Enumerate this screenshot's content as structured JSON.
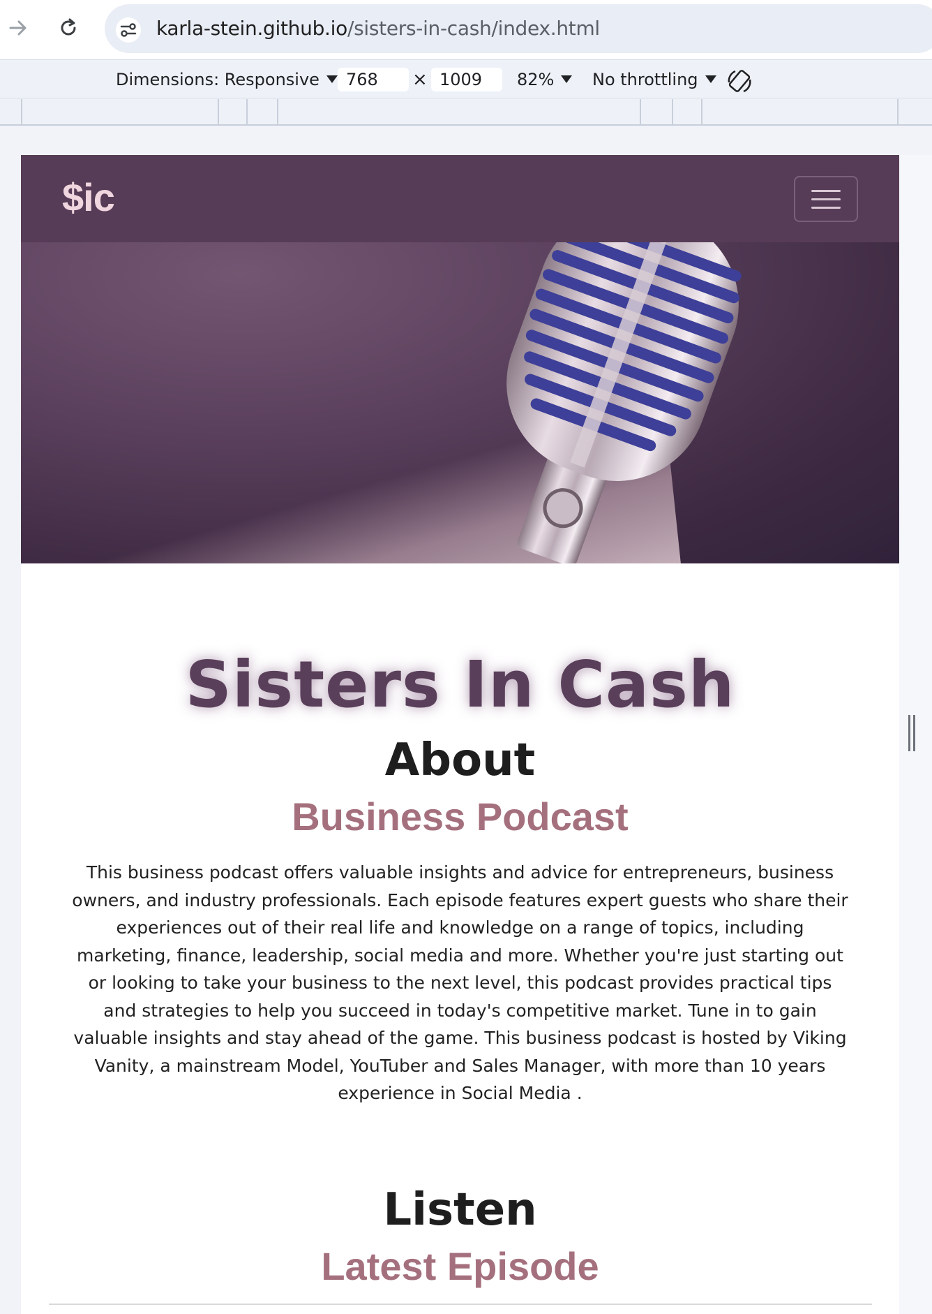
{
  "browser": {
    "url_host": "karla-stein.github.io",
    "url_path": "/sisters-in-cash/index.html"
  },
  "devtools": {
    "dimensions_label": "Dimensions: Responsive",
    "width_value": "768",
    "height_value": "1009",
    "times": "×",
    "zoom": "82%",
    "throttling": "No throttling"
  },
  "navbar": {
    "brand": "$ic"
  },
  "hero": {
    "image": "microphone-photo"
  },
  "main": {
    "title": "Sisters In Cash",
    "about_heading": "About",
    "about_subheading": "Business Podcast",
    "about_text": "This business podcast offers valuable insights and advice for entrepreneurs, business owners, and industry professionals. Each episode features expert guests who share their experiences out of their real life and knowledge on a range of topics, including marketing, finance, leadership, social media and more. Whether you're just starting out or looking to take your business to the next level, this podcast provides practical tips and strategies to help you succeed in today's competitive market. Tune in to gain valuable insights and stay ahead of the game. This business podcast is hosted by Viking Vanity, a mainstream Model, YouTuber and Sales Manager, with more than 10 years experience in Social Media .",
    "listen_heading": "Listen",
    "listen_subheading": "Latest Episode"
  },
  "colors": {
    "navbar_bg": "#573c57",
    "brand_text": "#f0d6de",
    "title_text": "#5a3f5a",
    "subheading_text": "#a5707e"
  }
}
